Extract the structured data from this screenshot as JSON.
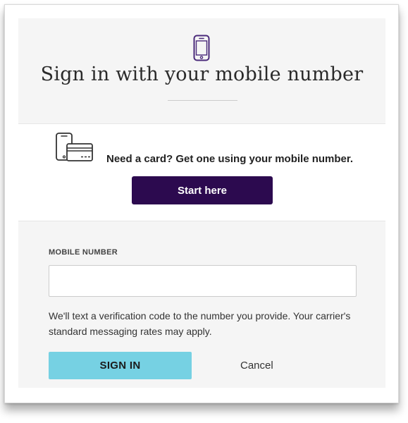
{
  "header": {
    "title": "Sign in with your mobile number"
  },
  "promo": {
    "text": "Need a card? Get one using your mobile number.",
    "start_label": "Start here"
  },
  "signin": {
    "field_label": "MOBILE NUMBER",
    "mobile_value": "",
    "mobile_placeholder": "",
    "disclaimer": "We'll text a verification code to the number you provide. Your carrier's standard messaging rates may apply.",
    "signin_label": "SIGN IN",
    "cancel_label": "Cancel"
  },
  "colors": {
    "accent_purple": "#2c0a4f",
    "icon_purple": "#4a2a7a",
    "signin_button": "#76d1e3",
    "panel_gray": "#f5f5f5"
  },
  "icons": {
    "header": "mobile-phone-icon",
    "promo": "phone-and-card-icon"
  }
}
